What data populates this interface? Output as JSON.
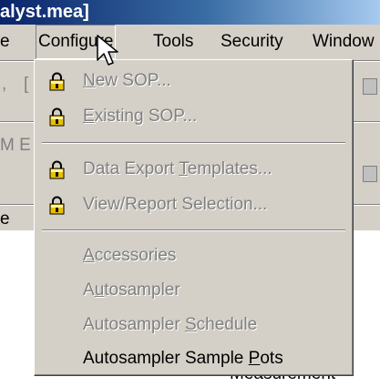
{
  "window": {
    "title_fragment": "alyst.mea]"
  },
  "menubar": {
    "items": [
      {
        "label": "e"
      },
      {
        "label": "Configure"
      },
      {
        "label": "Tools"
      },
      {
        "label": "Security"
      },
      {
        "label": "Window"
      }
    ]
  },
  "background": {
    "toolbar_fragment_1": ",",
    "toolbar_fragment_2": "[",
    "row_fragment_1": "M E",
    "row_fragment_2": "e",
    "measurement_fragment": "Measurement"
  },
  "configure_menu": {
    "groups": [
      [
        {
          "before": "",
          "mnemonic": "N",
          "after": "ew SOP...",
          "enabled": false,
          "icon": "padlock-icon"
        },
        {
          "before": "",
          "mnemonic": "E",
          "after": "xisting SOP...",
          "enabled": false,
          "icon": "padlock-icon"
        }
      ],
      [
        {
          "before": "Data Export ",
          "mnemonic": "T",
          "after": "emplates...",
          "enabled": false,
          "icon": "padlock-icon"
        },
        {
          "before": "View/Report Selection...",
          "mnemonic": "",
          "after": "",
          "enabled": false,
          "icon": "padlock-icon"
        }
      ],
      [
        {
          "before": "",
          "mnemonic": "A",
          "after": "ccessories",
          "enabled": false,
          "icon": ""
        },
        {
          "before": "A",
          "mnemonic": "u",
          "after": "tosampler",
          "enabled": false,
          "icon": ""
        },
        {
          "before": "Autosampler ",
          "mnemonic": "S",
          "after": "chedule",
          "enabled": false,
          "icon": ""
        },
        {
          "before": "Autosampler Sample ",
          "mnemonic": "P",
          "after": "ots",
          "enabled": true,
          "icon": ""
        }
      ]
    ]
  },
  "colors": {
    "face": "#d4d0c8",
    "disabled_text": "#808080",
    "title_bar": "#0a246a",
    "lock_gold": "#e8c000"
  }
}
